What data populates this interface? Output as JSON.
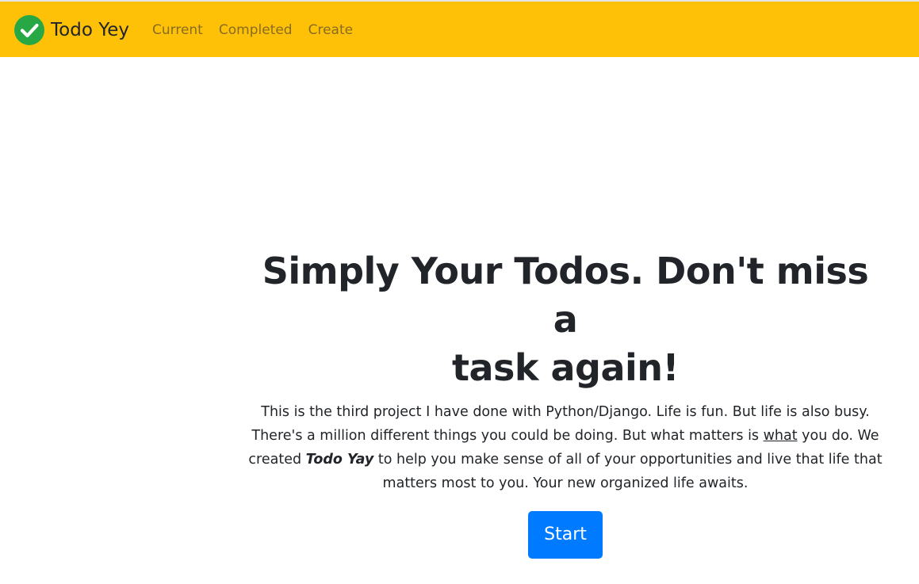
{
  "navbar": {
    "brand_logo_icon": "check-circle-icon",
    "brand_text": "Todo Yey",
    "links": [
      {
        "label": "Current"
      },
      {
        "label": "Completed"
      },
      {
        "label": "Create"
      }
    ],
    "background_color": "#ffc107"
  },
  "hero": {
    "title_line1": "Simply Your Todos. Don't miss a",
    "title_line2": "task again!",
    "paragraph": {
      "part1": "This is the third project I have done with Python/Django. Life is fun. But life is also busy. There's a million different things you could be doing. But what matters is ",
      "underlined": "what",
      "part2": " you do. We created ",
      "emphasis": "Todo Yay",
      "part3": " to help you make sense of all of your opportunities and live that life that matters most to you. Your new organized life awaits."
    },
    "start_button_label": "Start",
    "start_button_color": "#007bff"
  }
}
